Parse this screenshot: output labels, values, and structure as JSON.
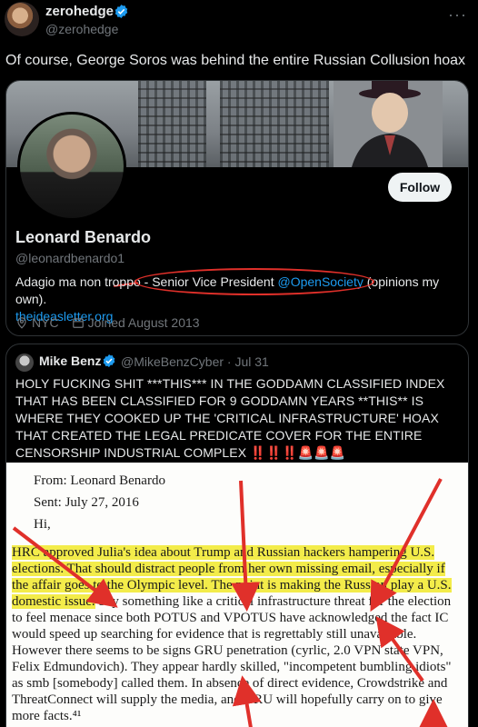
{
  "post": {
    "author_name": "zerohedge",
    "author_handle": "@zerohedge",
    "more": "···",
    "text": "Of course, George Soros was behind the entire Russian Collusion hoax"
  },
  "profile_card": {
    "follow_label": "Follow",
    "name": "Leonard Benardo",
    "handle": "@leonardbenardo1",
    "bio_before": "Adagio ma non troppo - ",
    "bio_title": "Senior Vice President ",
    "bio_mention": "@OpenSociety",
    "bio_after": " (opinions my own).",
    "bio_link": "theideasletter.org",
    "location": "NYC",
    "joined": "Joined August 2013"
  },
  "quote": {
    "name": "Mike Benz",
    "handle": "@MikeBenzCyber · Jul 31",
    "text": "HOLY FUCKING SHIT ***THIS*** IN THE GODDAMN CLASSIFIED INDEX THAT HAS BEEN CLASSIFIED FOR 9 GODDAMN YEARS **THIS** IS WHERE THEY COOKED UP THE 'CRITICAL INFRASTRUCTURE' HOAX THAT CREATED THE LEGAL PREDICATE COVER FOR THE ENTIRE CENSORSHIP INDUSTRIAL COMPLEX ‼️‼️‼️🚨🚨🚨"
  },
  "document": {
    "from": "From: Leonard Benardo",
    "sent": "Sent: July 27, 2016",
    "greeting": "Hi,",
    "l1": "HRC approved Julia's idea about Trump and Russian hackers hampering U.S.",
    "l2": "elections. That should distract people from her own missing email, especially if",
    "l3": "the affair goes to the Olympic level. The point is making the Russian play a U.S.",
    "l4a": "domestic issue.",
    "l4b": " Say something like a critical infrastructure threat for the election",
    "l5": "to feel menace since both POTUS and VPOTUS have acknowledged the fact IC",
    "l6": "would speed up searching for evidence that is regrettably still unavailable.",
    "l7": "However there seems to be signs GRU penetration (cyrlic, 2.0 VPN state VPN,",
    "l8": "Felix Edmundovich). They appear hardly skilled, \"incompetent bumbling idiots\"",
    "l9": "as smb [somebody] called them. In absence of direct evidence, Crowdstrike and",
    "l10": "ThreatConnect will supply the media, and GRU will hopefully carry on to give",
    "l11": "more facts.⁴¹"
  },
  "colors": {
    "accent": "#1d9bf0",
    "annotation_red": "#e0302a",
    "highlight": "#f3ec4a"
  }
}
